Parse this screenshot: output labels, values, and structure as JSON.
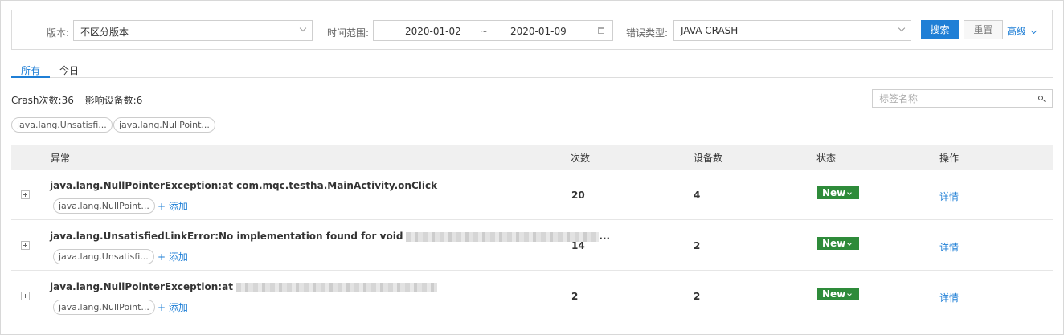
{
  "filters": {
    "version_label": "版本:",
    "version_value": "不区分版本",
    "time_label": "时间范围:",
    "date_start": "2020-01-02",
    "date_separator": "~",
    "date_end": "2020-01-09",
    "error_type_label": "错误类型:",
    "error_type_value": "JAVA CRASH",
    "search_button": "搜索",
    "reset_button": "重置",
    "advanced_label": "高级"
  },
  "tabs": [
    {
      "label": "所有",
      "active": true
    },
    {
      "label": "今日",
      "active": false
    }
  ],
  "stats": {
    "crash_count": "Crash次数:36",
    "device_count": "影响设备数:6"
  },
  "tag_search": {
    "placeholder": "标签名称"
  },
  "tag_chips": [
    "java.lang.Unsatisfi...",
    "java.lang.NullPoint..."
  ],
  "table": {
    "headers": {
      "exception": "异常",
      "count": "次数",
      "devices": "设备数",
      "status": "状态",
      "actions": "操作"
    },
    "rows": [
      {
        "title": "java.lang.NullPointerException:at com.mqc.testha.MainActivity.onClick",
        "tag": "java.lang.NullPoint...",
        "add_label": "+ 添加",
        "count": "20",
        "devices": "4",
        "status": "New",
        "detail_label": "详情"
      },
      {
        "title": "java.lang.UnsatisfiedLinkError:No implementation found for void",
        "title_suffix": "...",
        "tag": "java.lang.Unsatisfi...",
        "add_label": "+ 添加",
        "count": "14",
        "devices": "2",
        "status": "New",
        "detail_label": "详情"
      },
      {
        "title": "java.lang.NullPointerException:at",
        "tag": "java.lang.NullPoint...",
        "add_label": "+ 添加",
        "count": "2",
        "devices": "2",
        "status": "New",
        "detail_label": "详情"
      }
    ]
  },
  "colors": {
    "primary": "#1f7fd6",
    "status_new": "#2e8b3a",
    "header_bg": "#f0f0f0"
  },
  "icons": [
    "chevron-down-icon",
    "calendar-icon",
    "search-icon",
    "expand-plus-icon"
  ]
}
